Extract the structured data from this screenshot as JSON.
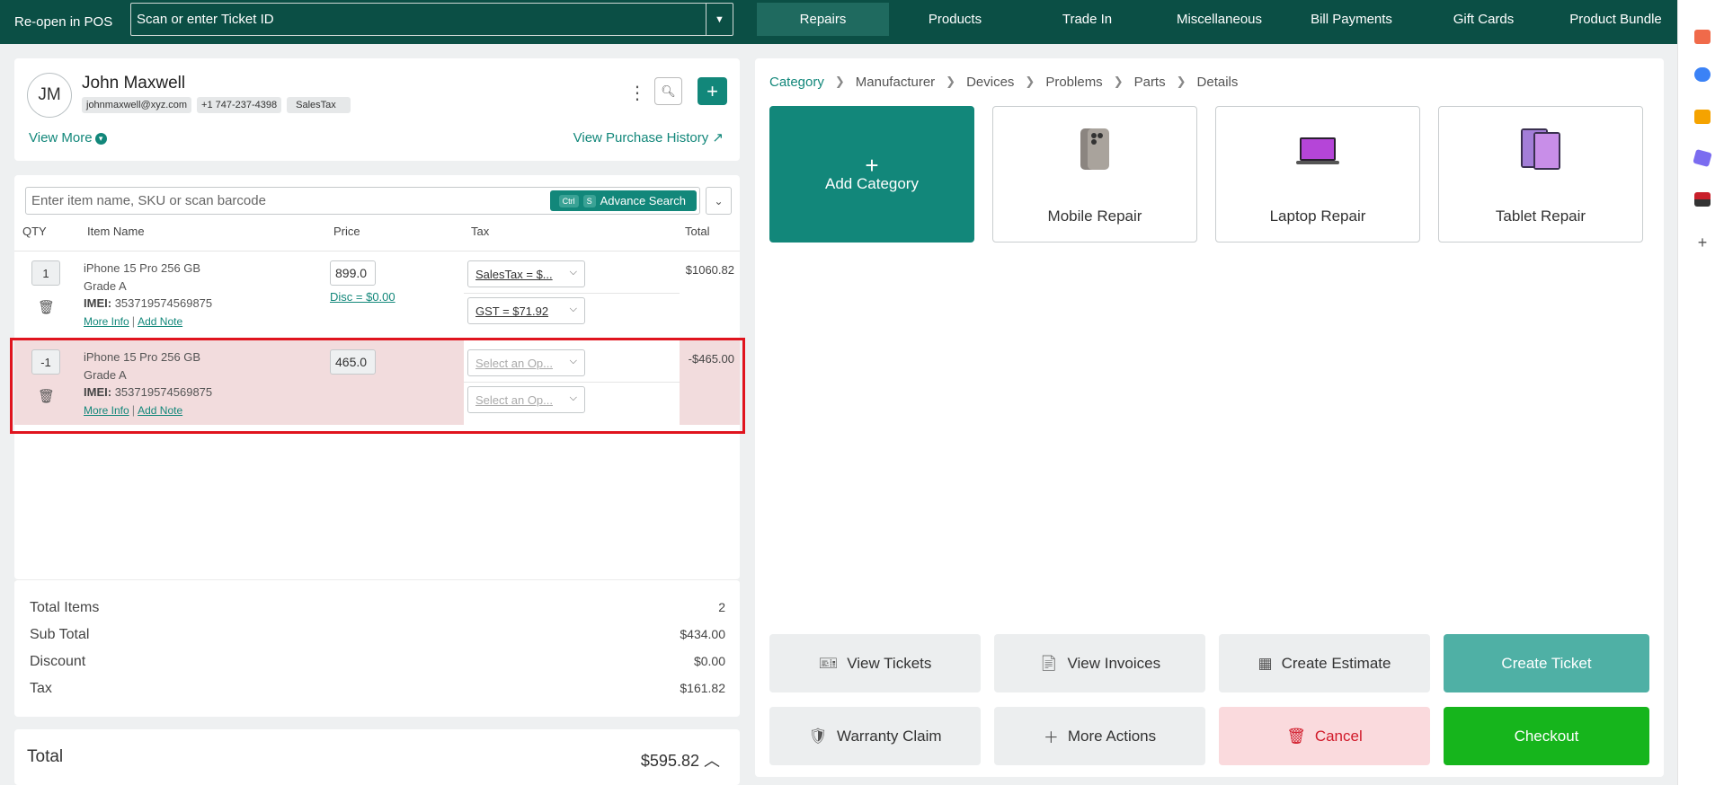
{
  "topbar": {
    "reopen_label": "Re-open in POS",
    "ticket_placeholder": "Scan or enter Ticket ID",
    "tabs": [
      {
        "label": "Repairs",
        "active": true
      },
      {
        "label": "Products"
      },
      {
        "label": "Trade In"
      },
      {
        "label": "Miscellaneous"
      },
      {
        "label": "Bill Payments"
      },
      {
        "label": "Gift Cards"
      },
      {
        "label": "Product Bundle"
      }
    ]
  },
  "customer": {
    "initials": "JM",
    "name": "John Maxwell",
    "email": "johnmaxwell@xyz.com",
    "phone": "+1 747-237-4398",
    "tax_tag": "SalesTax",
    "view_more": "View More",
    "view_history": "View Purchase History"
  },
  "cart": {
    "search_placeholder": "Enter item name, SKU or scan barcode",
    "kbd_ctrl": "Ctrl",
    "kbd_s": "S",
    "advance_search": "Advance Search",
    "columns": {
      "qty": "QTY",
      "item": "Item Name",
      "price": "Price",
      "tax": "Tax",
      "total": "Total"
    },
    "items": [
      {
        "qty": "1",
        "name": "iPhone 15 Pro 256 GB",
        "grade": "Grade A",
        "imei_label": "IMEI:",
        "imei": "353719574569875",
        "more_info": "More Info",
        "add_note": "Add Note",
        "price": "899.0",
        "discount": "Disc = $0.00",
        "tax1": "SalesTax = $...",
        "tax2": "GST = $71.92",
        "total": "$1060.82"
      },
      {
        "qty": "-1",
        "name": "iPhone 15 Pro 256 GB",
        "grade": "Grade A",
        "imei_label": "IMEI:",
        "imei": "353719574569875",
        "more_info": "More Info",
        "add_note": "Add Note",
        "price": "465.0",
        "tax1": "Select an Op...",
        "tax2": "Select an Op...",
        "total": "-$465.00"
      }
    ]
  },
  "totals": {
    "total_items_label": "Total Items",
    "total_items": "2",
    "subtotal_label": "Sub Total",
    "subtotal": "$434.00",
    "discount_label": "Discount",
    "discount": "$0.00",
    "tax_label": "Tax",
    "tax": "$161.82",
    "grand_label": "Total",
    "grand": "$595.82"
  },
  "catalog": {
    "breadcrumb": [
      "Category",
      "Manufacturer",
      "Devices",
      "Problems",
      "Parts",
      "Details"
    ],
    "add_category": "Add Category",
    "tiles": [
      "Mobile Repair",
      "Laptop Repair",
      "Tablet Repair"
    ]
  },
  "actions": {
    "view_tickets": "View Tickets",
    "view_invoices": "View Invoices",
    "create_estimate": "Create Estimate",
    "create_ticket": "Create Ticket",
    "warranty_claim": "Warranty Claim",
    "more_actions": "More Actions",
    "cancel": "Cancel",
    "checkout": "Checkout"
  },
  "colors": {
    "brand": "#0b4f45",
    "accent": "#12877a",
    "checkout": "#16b51c",
    "cancel": "#d11a2a",
    "highlight": "#e0141e"
  }
}
